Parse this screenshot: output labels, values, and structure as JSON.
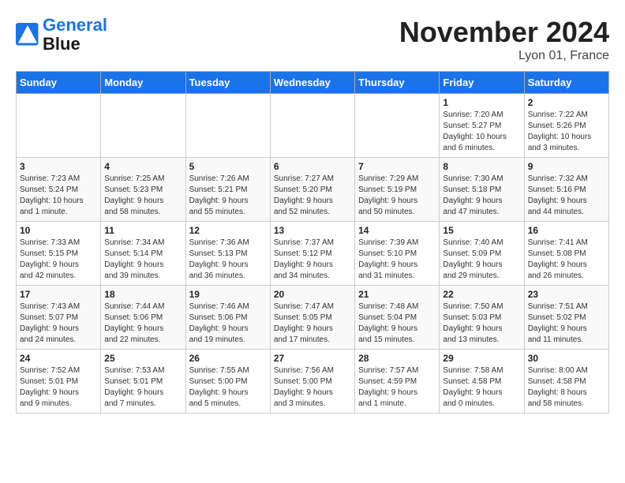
{
  "logo": {
    "line1": "General",
    "line2": "Blue"
  },
  "title": "November 2024",
  "location": "Lyon 01, France",
  "days_header": [
    "Sunday",
    "Monday",
    "Tuesday",
    "Wednesday",
    "Thursday",
    "Friday",
    "Saturday"
  ],
  "weeks": [
    [
      {
        "num": "",
        "info": ""
      },
      {
        "num": "",
        "info": ""
      },
      {
        "num": "",
        "info": ""
      },
      {
        "num": "",
        "info": ""
      },
      {
        "num": "",
        "info": ""
      },
      {
        "num": "1",
        "info": "Sunrise: 7:20 AM\nSunset: 5:27 PM\nDaylight: 10 hours\nand 6 minutes."
      },
      {
        "num": "2",
        "info": "Sunrise: 7:22 AM\nSunset: 5:26 PM\nDaylight: 10 hours\nand 3 minutes."
      }
    ],
    [
      {
        "num": "3",
        "info": "Sunrise: 7:23 AM\nSunset: 5:24 PM\nDaylight: 10 hours\nand 1 minute."
      },
      {
        "num": "4",
        "info": "Sunrise: 7:25 AM\nSunset: 5:23 PM\nDaylight: 9 hours\nand 58 minutes."
      },
      {
        "num": "5",
        "info": "Sunrise: 7:26 AM\nSunset: 5:21 PM\nDaylight: 9 hours\nand 55 minutes."
      },
      {
        "num": "6",
        "info": "Sunrise: 7:27 AM\nSunset: 5:20 PM\nDaylight: 9 hours\nand 52 minutes."
      },
      {
        "num": "7",
        "info": "Sunrise: 7:29 AM\nSunset: 5:19 PM\nDaylight: 9 hours\nand 50 minutes."
      },
      {
        "num": "8",
        "info": "Sunrise: 7:30 AM\nSunset: 5:18 PM\nDaylight: 9 hours\nand 47 minutes."
      },
      {
        "num": "9",
        "info": "Sunrise: 7:32 AM\nSunset: 5:16 PM\nDaylight: 9 hours\nand 44 minutes."
      }
    ],
    [
      {
        "num": "10",
        "info": "Sunrise: 7:33 AM\nSunset: 5:15 PM\nDaylight: 9 hours\nand 42 minutes."
      },
      {
        "num": "11",
        "info": "Sunrise: 7:34 AM\nSunset: 5:14 PM\nDaylight: 9 hours\nand 39 minutes."
      },
      {
        "num": "12",
        "info": "Sunrise: 7:36 AM\nSunset: 5:13 PM\nDaylight: 9 hours\nand 36 minutes."
      },
      {
        "num": "13",
        "info": "Sunrise: 7:37 AM\nSunset: 5:12 PM\nDaylight: 9 hours\nand 34 minutes."
      },
      {
        "num": "14",
        "info": "Sunrise: 7:39 AM\nSunset: 5:10 PM\nDaylight: 9 hours\nand 31 minutes."
      },
      {
        "num": "15",
        "info": "Sunrise: 7:40 AM\nSunset: 5:09 PM\nDaylight: 9 hours\nand 29 minutes."
      },
      {
        "num": "16",
        "info": "Sunrise: 7:41 AM\nSunset: 5:08 PM\nDaylight: 9 hours\nand 26 minutes."
      }
    ],
    [
      {
        "num": "17",
        "info": "Sunrise: 7:43 AM\nSunset: 5:07 PM\nDaylight: 9 hours\nand 24 minutes."
      },
      {
        "num": "18",
        "info": "Sunrise: 7:44 AM\nSunset: 5:06 PM\nDaylight: 9 hours\nand 22 minutes."
      },
      {
        "num": "19",
        "info": "Sunrise: 7:46 AM\nSunset: 5:06 PM\nDaylight: 9 hours\nand 19 minutes."
      },
      {
        "num": "20",
        "info": "Sunrise: 7:47 AM\nSunset: 5:05 PM\nDaylight: 9 hours\nand 17 minutes."
      },
      {
        "num": "21",
        "info": "Sunrise: 7:48 AM\nSunset: 5:04 PM\nDaylight: 9 hours\nand 15 minutes."
      },
      {
        "num": "22",
        "info": "Sunrise: 7:50 AM\nSunset: 5:03 PM\nDaylight: 9 hours\nand 13 minutes."
      },
      {
        "num": "23",
        "info": "Sunrise: 7:51 AM\nSunset: 5:02 PM\nDaylight: 9 hours\nand 11 minutes."
      }
    ],
    [
      {
        "num": "24",
        "info": "Sunrise: 7:52 AM\nSunset: 5:01 PM\nDaylight: 9 hours\nand 9 minutes."
      },
      {
        "num": "25",
        "info": "Sunrise: 7:53 AM\nSunset: 5:01 PM\nDaylight: 9 hours\nand 7 minutes."
      },
      {
        "num": "26",
        "info": "Sunrise: 7:55 AM\nSunset: 5:00 PM\nDaylight: 9 hours\nand 5 minutes."
      },
      {
        "num": "27",
        "info": "Sunrise: 7:56 AM\nSunset: 5:00 PM\nDaylight: 9 hours\nand 3 minutes."
      },
      {
        "num": "28",
        "info": "Sunrise: 7:57 AM\nSunset: 4:59 PM\nDaylight: 9 hours\nand 1 minute."
      },
      {
        "num": "29",
        "info": "Sunrise: 7:58 AM\nSunset: 4:58 PM\nDaylight: 9 hours\nand 0 minutes."
      },
      {
        "num": "30",
        "info": "Sunrise: 8:00 AM\nSunset: 4:58 PM\nDaylight: 8 hours\nand 58 minutes."
      }
    ]
  ]
}
